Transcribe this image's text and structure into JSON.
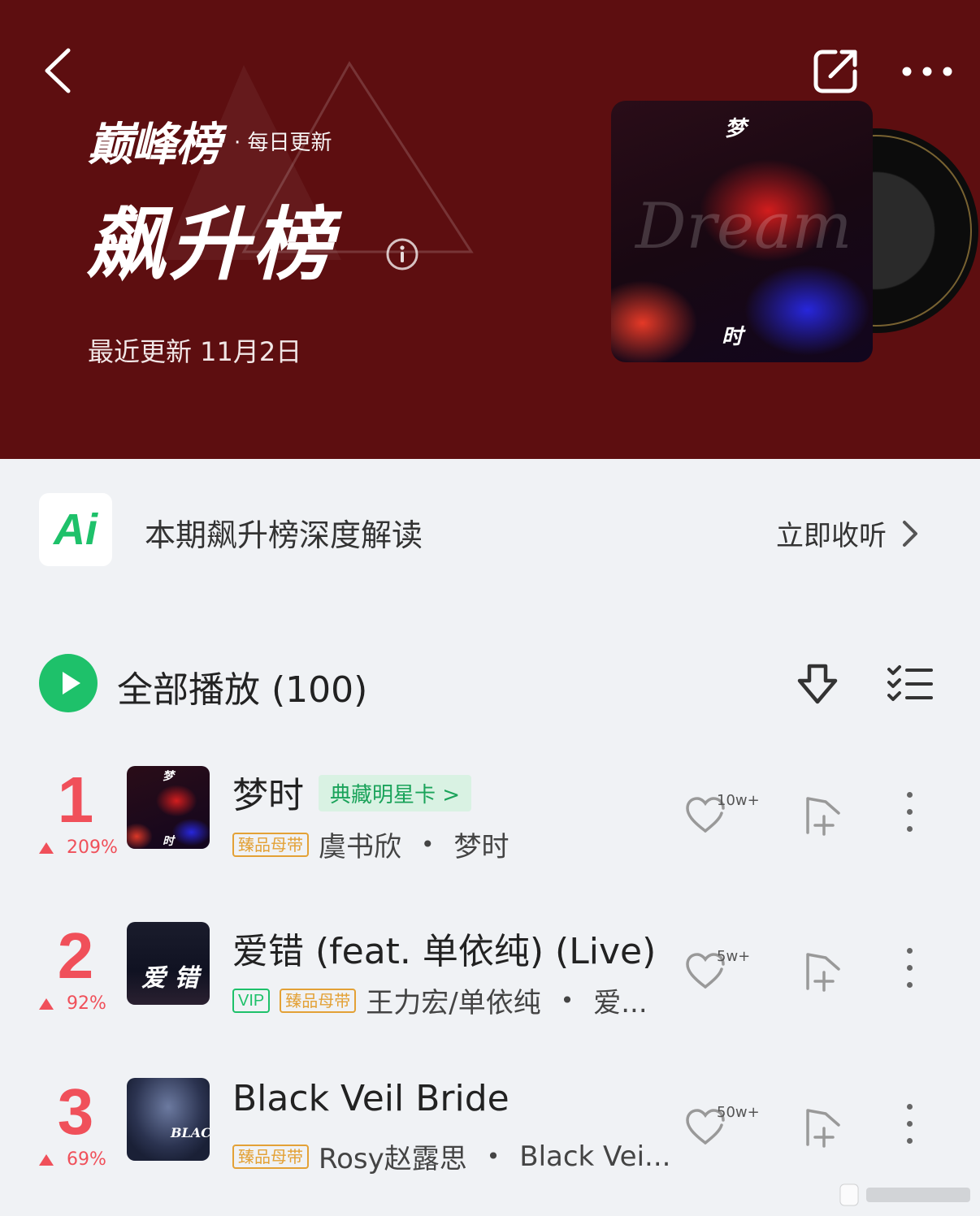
{
  "header": {
    "brand_name": "巅峰榜",
    "brand_tag": "· 每日更新",
    "chart_title": "飙升榜",
    "update_date": "最近更新 11月2日",
    "cover": {
      "top_text": "梦",
      "bottom_text": "时",
      "script_text": "Dream"
    },
    "background_color": "#5d0e10"
  },
  "ai_bar": {
    "logo_text": "Ai",
    "text": "本期飙升榜深度解读",
    "action_label": "立即收听"
  },
  "play_all": {
    "label": "全部播放 (100)"
  },
  "songs": [
    {
      "rank": "1",
      "trend": "209%",
      "title": "梦时",
      "star_card": "典藏明星卡 >",
      "badges": [
        "臻品母带"
      ],
      "artist": "虞书欣",
      "album": "梦时",
      "likes": "10w+",
      "thumb_top": "梦",
      "thumb_bottom": "时"
    },
    {
      "rank": "2",
      "trend": "92%",
      "title": "爱错 (feat. 单依纯) (Live)",
      "badges": [
        "VIP",
        "臻品母带"
      ],
      "artist": "王力宏/单依纯",
      "album": "爱...",
      "likes": "5w+",
      "thumb_text": "爱 错"
    },
    {
      "rank": "3",
      "trend": "69%",
      "title": "Black Veil Bride",
      "badges": [
        "臻品母带"
      ],
      "artist": "Rosy赵露思",
      "album": "Black Vei...",
      "likes": "50w+",
      "thumb_text": "BLACK"
    }
  ],
  "colors": {
    "accent_green": "#1ec16a",
    "rank_red": "#f0505a",
    "badge_gold": "#e3a136"
  }
}
